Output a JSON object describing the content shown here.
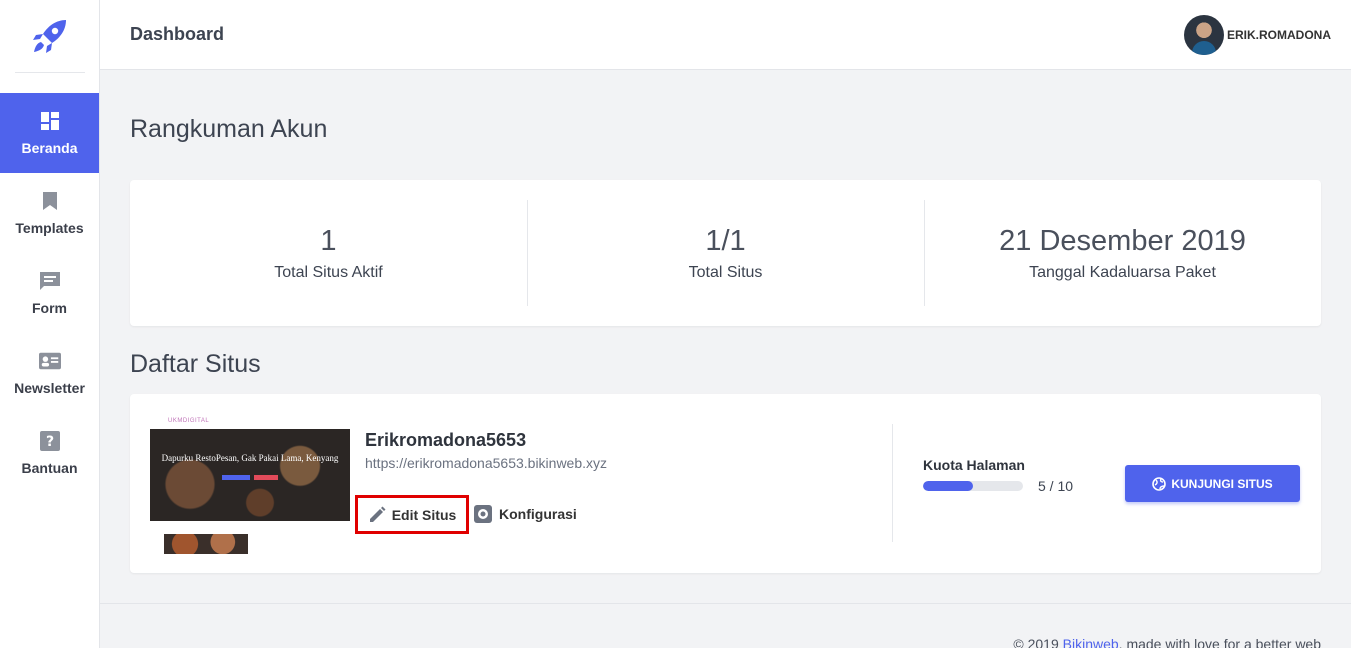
{
  "sidebar": {
    "items": [
      {
        "label": "Beranda",
        "icon": "dashboard-icon",
        "active": true
      },
      {
        "label": "Templates",
        "icon": "bookmark-icon",
        "active": false
      },
      {
        "label": "Form",
        "icon": "message-icon",
        "active": false
      },
      {
        "label": "Newsletter",
        "icon": "contact-card-icon",
        "active": false
      },
      {
        "label": "Bantuan",
        "icon": "help-icon",
        "active": false
      }
    ]
  },
  "header": {
    "title": "Dashboard",
    "username": "ERIK.ROMADONA"
  },
  "summary": {
    "heading": "Rangkuman Akun",
    "stats": [
      {
        "value": "1",
        "label": "Total Situs Aktif"
      },
      {
        "value": "1/1",
        "label": "Total Situs"
      },
      {
        "value": "21 Desember 2019",
        "label": "Tanggal Kadaluarsa Paket"
      }
    ]
  },
  "sites": {
    "heading": "Daftar Situs",
    "list": [
      {
        "name": "Erikromadona5653",
        "url": "https://erikromadona5653.bikinweb.xyz",
        "edit_label": "Edit Situs",
        "config_label": "Konfigurasi",
        "quota_label": "Kuota Halaman",
        "quota_used": 5,
        "quota_total": 10,
        "quota_text": "5 / 10",
        "visit_label": "KUNJUNGI SITUS",
        "thumbnail": {
          "brand": "UKMDIGITAL",
          "hero_title": "Dapurku RestoPesan, Gak Pakai Lama, Kenyang"
        }
      }
    ]
  },
  "footer": {
    "prefix": "© 2019 ",
    "link": "Bikinweb",
    "suffix": ", made with love for a better web"
  },
  "colors": {
    "accent": "#4f63ec",
    "highlight": "#e00000"
  }
}
